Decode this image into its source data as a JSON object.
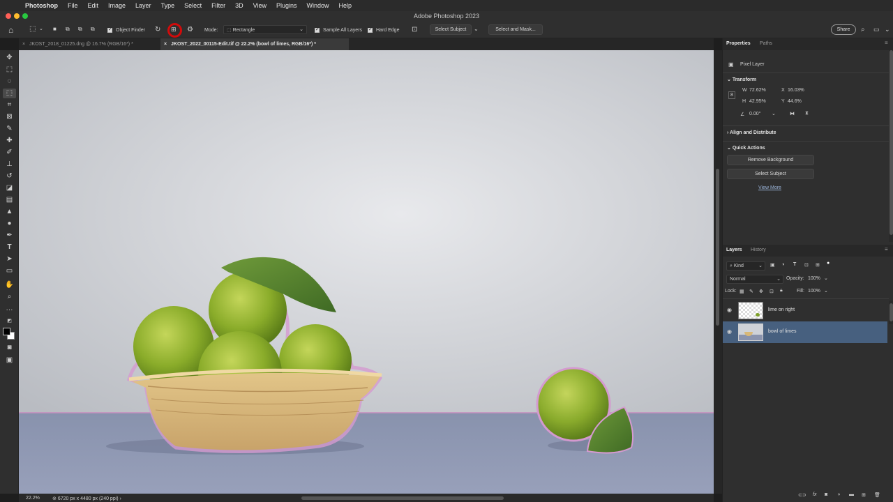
{
  "menubar": {
    "items": [
      "Photoshop",
      "File",
      "Edit",
      "Image",
      "Layer",
      "Type",
      "Select",
      "Filter",
      "3D",
      "View",
      "Plugins",
      "Window",
      "Help"
    ]
  },
  "window": {
    "title": "Adobe Photoshop 2023"
  },
  "options_bar": {
    "object_finder_label": "Object Finder",
    "mode_label": "Mode:",
    "mode_value": "Rectangle",
    "sample_all_layers_label": "Sample All Layers",
    "hard_edge_label": "Hard Edge",
    "select_subject_label": "Select Subject",
    "select_and_mask_label": "Select and Mask...",
    "share_label": "Share",
    "highlight_color": "#d10b0b"
  },
  "tabs": [
    {
      "label": "JKOST_2018_01225.dng @ 16.7% (RGB/16*) *",
      "active": false
    },
    {
      "label": "JKOST_2022_00115-Edit.tif @ 22.2% (bowl of limes, RGB/16*) *",
      "active": true
    }
  ],
  "status": {
    "zoom": "22.2%",
    "doc_info": "6720 px x 4480 px (240 ppi)"
  },
  "properties": {
    "tabs": [
      "Properties",
      "Paths"
    ],
    "layer_type": "Pixel Layer",
    "transform_title": "Transform",
    "w_label": "W",
    "w_value": "72.62%",
    "h_label": "H",
    "h_value": "42.95%",
    "x_label": "X",
    "x_value": "16.03%",
    "y_label": "Y",
    "y_value": "44.6%",
    "angle_value": "0.00°",
    "align_title": "Align and Distribute",
    "quick_actions_title": "Quick Actions",
    "remove_bg_label": "Remove Background",
    "select_subject_label": "Select Subject",
    "view_more_label": "View More"
  },
  "layers_panel": {
    "tabs": [
      "Layers",
      "History"
    ],
    "filter_value": "Kind",
    "blend_mode": "Normal",
    "opacity_label": "Opacity:",
    "opacity_value": "100%",
    "lock_label": "Lock:",
    "fill_label": "Fill:",
    "fill_value": "100%",
    "layers": [
      {
        "name": "lime on right",
        "selected": false,
        "visible": true
      },
      {
        "name": "bowl of limes",
        "selected": true,
        "visible": true
      }
    ]
  },
  "icons": {
    "home": "home-icon",
    "select_tool": "object-selection-tool-icon",
    "refresh": "refresh-icon",
    "highlighted": "object-finder-overlay-icon",
    "settings": "gear-icon",
    "search": "search-icon"
  }
}
